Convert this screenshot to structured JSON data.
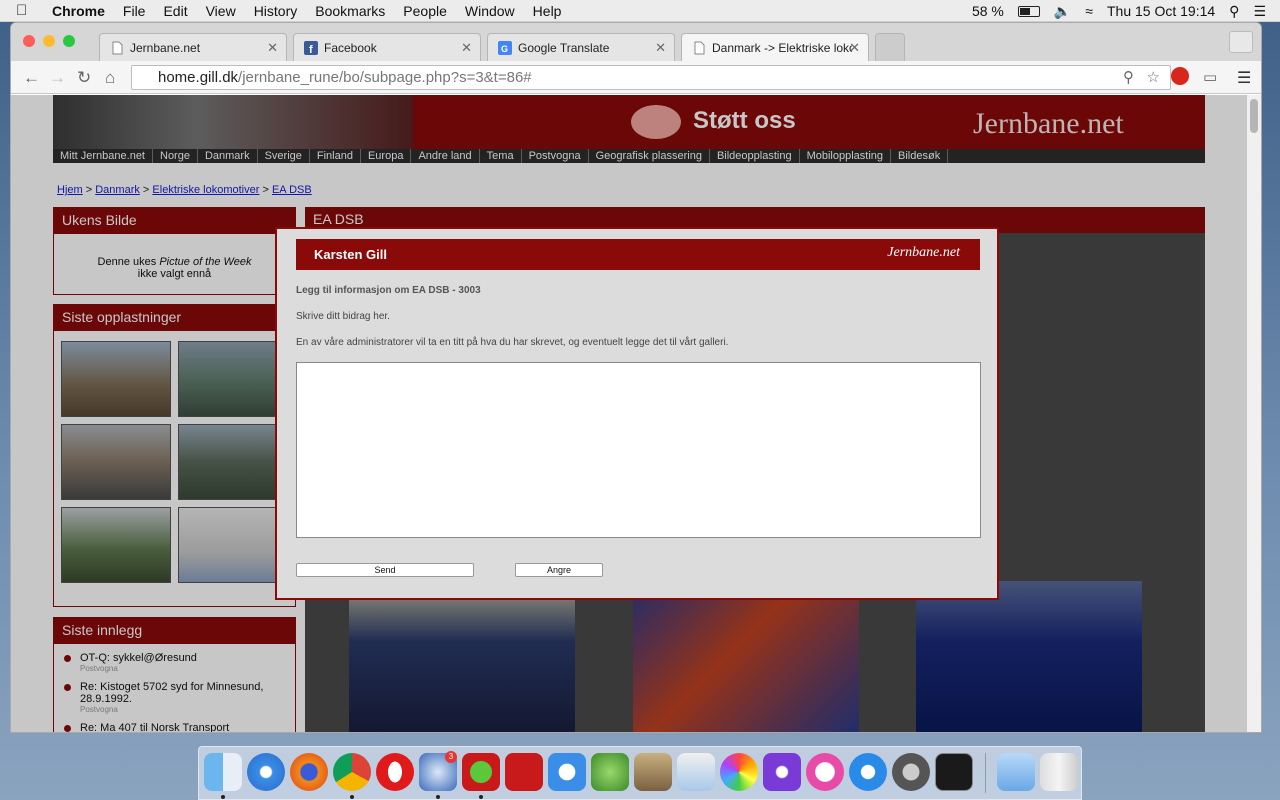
{
  "menubar": {
    "app": "Chrome",
    "items": [
      "File",
      "Edit",
      "View",
      "History",
      "Bookmarks",
      "People",
      "Window",
      "Help"
    ],
    "battery": "58 %",
    "clock": "Thu 15 Oct  19:14"
  },
  "tabs": [
    {
      "label": "Jernbane.net"
    },
    {
      "label": "Facebook"
    },
    {
      "label": "Google Translate"
    },
    {
      "label": "Danmark -> Elektriske loko"
    }
  ],
  "address": {
    "host": "home.gill.dk",
    "path": "/jernbane_rune/bo/subpage.php?s=3&t=86#"
  },
  "site": {
    "support": "Støtt oss",
    "brand": "Jernbane.net",
    "nav": [
      "Mitt Jernbane.net",
      "Norge",
      "Danmark",
      "Sverige",
      "Finland",
      "Europa",
      "Andre land",
      "Tema",
      "Postvogna",
      "Geografisk plassering",
      "Bildeopplasting",
      "Mobilopplasting",
      "Bildesøk"
    ],
    "breadcrumb": [
      "Hjem",
      "Danmark",
      "Elektriske lokomotiver",
      "EA DSB"
    ],
    "breadcrumb_sep": ">",
    "potw_head": "Ukens Bilde",
    "potw_text1": "Denne ukes",
    "potw_text2": "Pictue of the Week",
    "potw_text3": "ikke valgt ennå",
    "uploads_head": "Siste opplastninger",
    "posts_head": "Siste innlegg",
    "posts": [
      {
        "title": "OT-Q: sykkel@Øresund",
        "sub": "Postvogna"
      },
      {
        "title": "Re: Kistoget 5702 syd for Minnesund, 28.9.1992.",
        "sub": "Postvogna"
      },
      {
        "title": "Re: Ma 407 til Norsk Transport",
        "sub": ""
      }
    ],
    "main_head": "EA DSB"
  },
  "modal": {
    "title": "Karsten Gill",
    "logo": "Jernbane.net",
    "heading": "Legg til informasjon om EA DSB - 3003",
    "line1": "Skrive ditt bidrag her.",
    "line2": "En av våre administratorer vil ta en titt på hva du har skrevet, og eventuelt legge det til vårt galleri.",
    "send": "Send",
    "cancel": "Angre"
  },
  "dock": {
    "badge": "3"
  },
  "colors": {
    "brand_red": "#8a0a0a"
  }
}
